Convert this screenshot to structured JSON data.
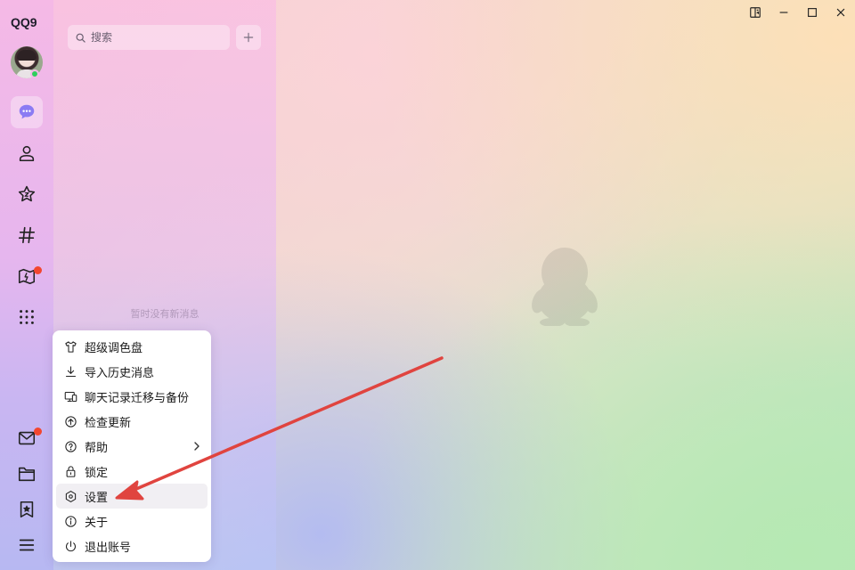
{
  "app": {
    "logo": "QQ9"
  },
  "search": {
    "placeholder": "搜索"
  },
  "chat_list": {
    "empty_text": "暂时没有新消息"
  },
  "sidebar": {
    "top_items": [
      {
        "icon": "chat-bubble-icon",
        "active": true
      },
      {
        "icon": "contacts-icon"
      },
      {
        "icon": "star-icon"
      },
      {
        "icon": "hashtag-icon"
      },
      {
        "icon": "map-icon",
        "badge": true
      },
      {
        "icon": "apps-grid-icon"
      }
    ],
    "bottom_items": [
      {
        "icon": "mail-icon",
        "badge": true
      },
      {
        "icon": "folder-icon"
      },
      {
        "icon": "bookmark-star-icon"
      },
      {
        "icon": "menu-icon"
      }
    ]
  },
  "menu": {
    "items": [
      {
        "label": "超级调色盘",
        "icon": "tshirt-icon"
      },
      {
        "label": "导入历史消息",
        "icon": "download-icon"
      },
      {
        "label": "聊天记录迁移与备份",
        "icon": "device-transfer-icon"
      },
      {
        "label": "检查更新",
        "icon": "upload-circle-icon"
      },
      {
        "label": "帮助",
        "icon": "question-circle-icon",
        "has_submenu": true
      },
      {
        "label": "锁定",
        "icon": "lock-icon"
      },
      {
        "label": "设置",
        "icon": "hexagon-settings-icon",
        "hovered": true
      },
      {
        "label": "关于",
        "icon": "info-circle-icon"
      },
      {
        "label": "退出账号",
        "icon": "power-icon"
      }
    ]
  },
  "colors": {
    "badge": "#f3462f",
    "online": "#2fcf5c",
    "active_icon": "#7c6ef2",
    "annotation_arrow": "#e0443f"
  }
}
